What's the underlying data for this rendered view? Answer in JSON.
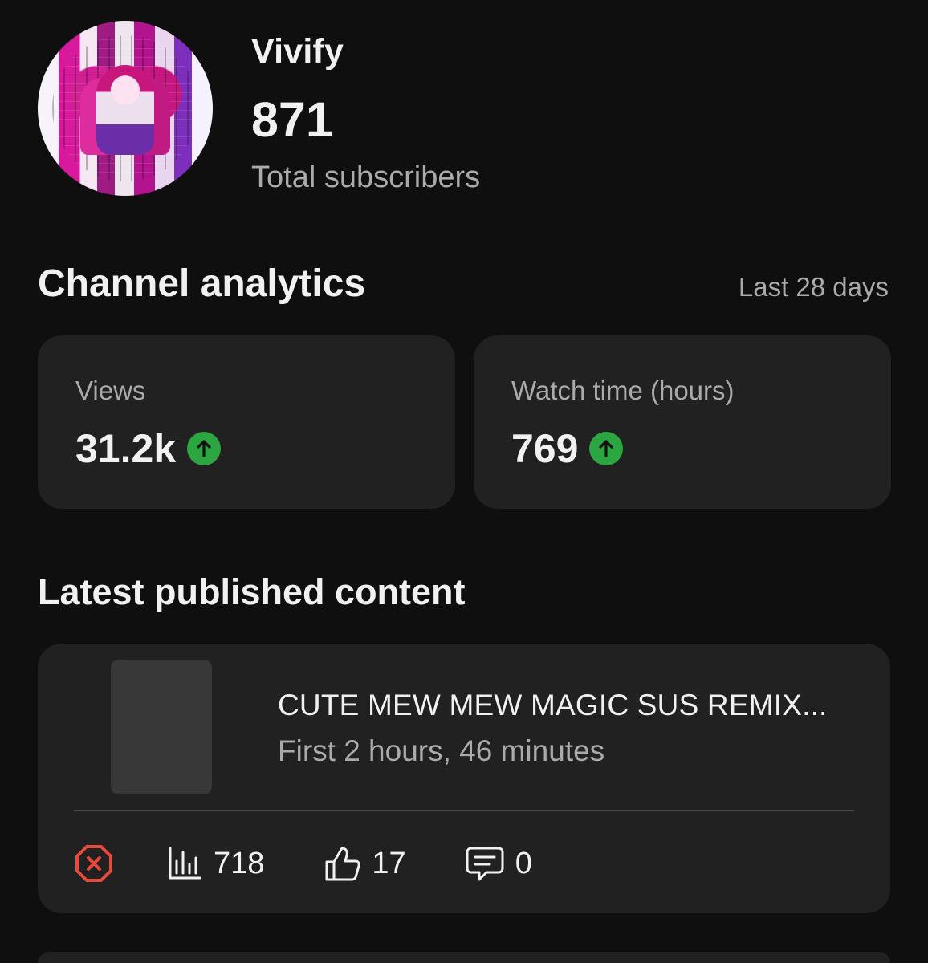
{
  "channel": {
    "name": "Vivify",
    "subscriber_count": "871",
    "subscriber_label": "Total subscribers"
  },
  "analytics": {
    "title": "Channel analytics",
    "period": "Last 28 days",
    "metrics": [
      {
        "label": "Views",
        "value": "31.2k",
        "trend_icon": "up-arrow-icon",
        "trend_color": "#2ba640"
      },
      {
        "label": "Watch time (hours)",
        "value": "769",
        "trend_icon": "up-arrow-icon",
        "trend_color": "#2ba640"
      }
    ]
  },
  "latest": {
    "title": "Latest published content",
    "video": {
      "title": "CUTE MEW MEW MAGIC SUS REMIX...",
      "meta": "First 2 hours, 46 minutes",
      "views": "718",
      "likes": "17",
      "comments": "0",
      "status_icon": "error-octagon-icon",
      "status_color": "#e64a3b"
    }
  },
  "colors": {
    "background": "#0f0f0f",
    "card": "#212121",
    "secondary_text": "#aaaaaa",
    "success": "#2ba640"
  }
}
